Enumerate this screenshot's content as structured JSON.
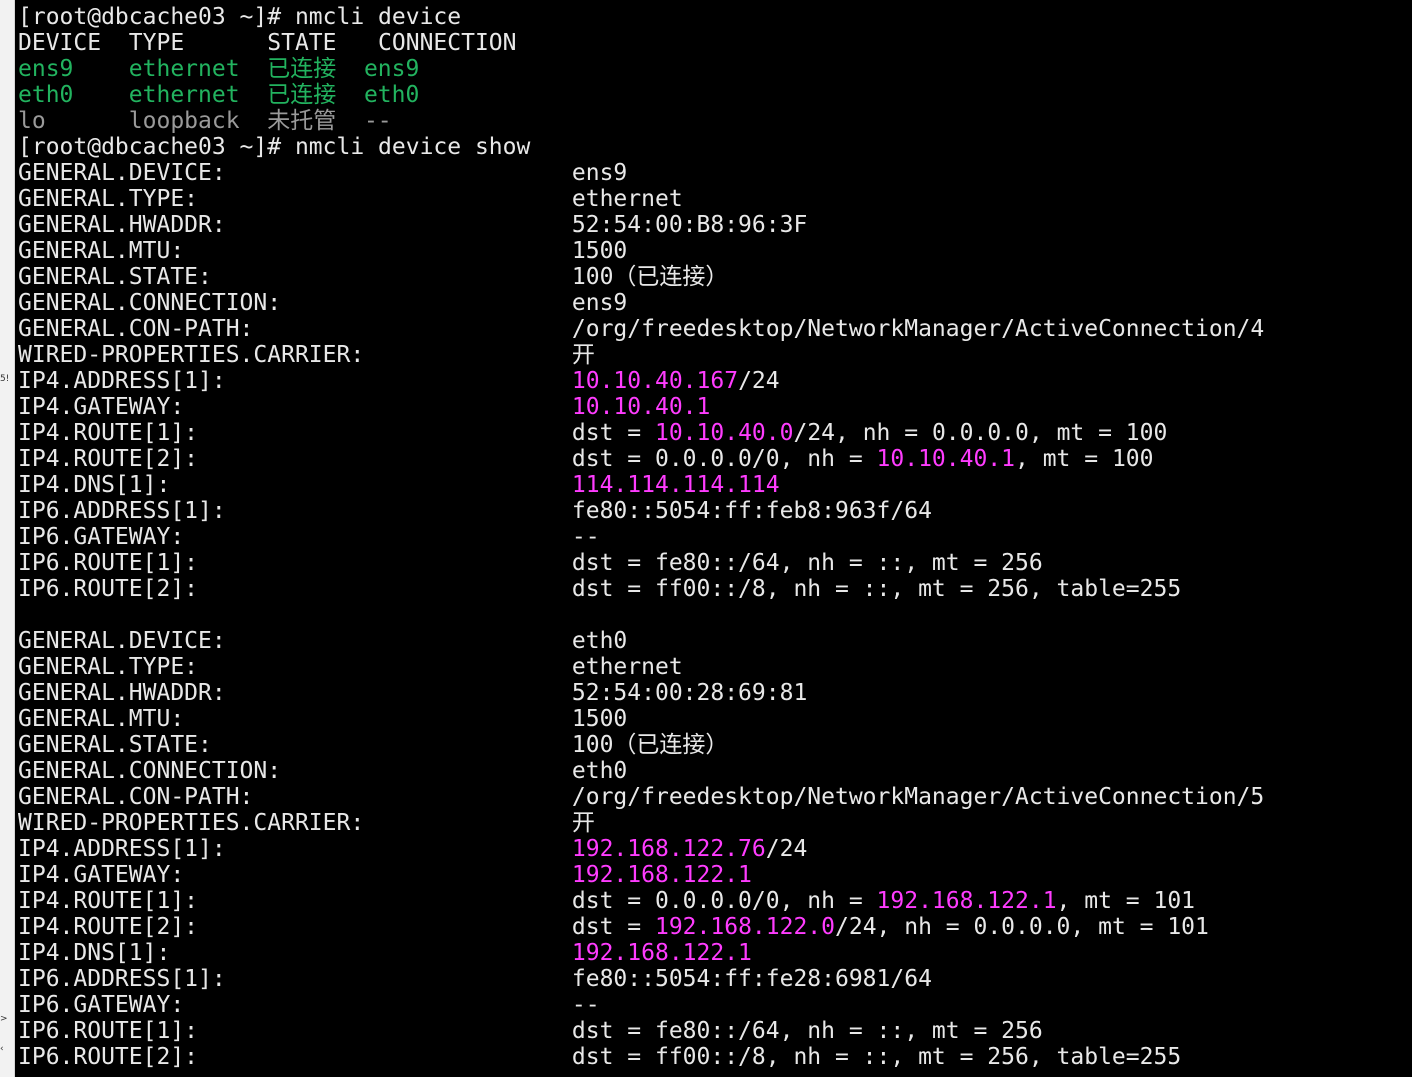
{
  "sidebar_marks": [
    "5!",
    ">",
    "‹"
  ],
  "colors": {
    "background": "#000000",
    "default_text": "#e8e8e8",
    "connected_green": "#22b35f",
    "unmanaged_gray": "#9a9a9a",
    "ip_magenta": "#ff3cff"
  },
  "lines": [
    {
      "segments": [
        {
          "text": "[root@dbcache03 ~]# nmcli device",
          "color": "white"
        }
      ]
    },
    {
      "segments": [
        {
          "text": "DEVICE  TYPE      STATE   CONNECTION",
          "color": "white"
        }
      ]
    },
    {
      "segments": [
        {
          "text": "ens9    ethernet  已连接  ens9",
          "color": "green"
        }
      ]
    },
    {
      "segments": [
        {
          "text": "eth0    ethernet  已连接  eth0",
          "color": "green"
        }
      ]
    },
    {
      "segments": [
        {
          "text": "lo      loopback  未托管  --",
          "color": "gray"
        }
      ]
    },
    {
      "segments": [
        {
          "text": "[root@dbcache03 ~]# nmcli device show",
          "color": "white"
        }
      ]
    },
    {
      "segments": [
        {
          "text": "GENERAL.DEVICE:                         ens9",
          "color": "white"
        }
      ]
    },
    {
      "segments": [
        {
          "text": "GENERAL.TYPE:                           ethernet",
          "color": "white"
        }
      ]
    },
    {
      "segments": [
        {
          "text": "GENERAL.HWADDR:                         52:54:00:B8:96:3F",
          "color": "white"
        }
      ]
    },
    {
      "segments": [
        {
          "text": "GENERAL.MTU:                            1500",
          "color": "white"
        }
      ]
    },
    {
      "segments": [
        {
          "text": "GENERAL.STATE:                          100（已连接）",
          "color": "white"
        }
      ]
    },
    {
      "segments": [
        {
          "text": "GENERAL.CONNECTION:                     ens9",
          "color": "white"
        }
      ]
    },
    {
      "segments": [
        {
          "text": "GENERAL.CON-PATH:                       /org/freedesktop/NetworkManager/ActiveConnection/4",
          "color": "white"
        }
      ]
    },
    {
      "segments": [
        {
          "text": "WIRED-PROPERTIES.CARRIER:               开",
          "color": "white"
        }
      ]
    },
    {
      "segments": [
        {
          "text": "IP4.ADDRESS[1]:                         ",
          "color": "white"
        },
        {
          "text": "10.10.40.167",
          "color": "mag"
        },
        {
          "text": "/24",
          "color": "white"
        }
      ]
    },
    {
      "segments": [
        {
          "text": "IP4.GATEWAY:                            ",
          "color": "white"
        },
        {
          "text": "10.10.40.1",
          "color": "mag"
        }
      ]
    },
    {
      "segments": [
        {
          "text": "IP4.ROUTE[1]:                           dst = ",
          "color": "white"
        },
        {
          "text": "10.10.40.0",
          "color": "mag"
        },
        {
          "text": "/24, nh = 0.0.0.0, mt = 100",
          "color": "white"
        }
      ]
    },
    {
      "segments": [
        {
          "text": "IP4.ROUTE[2]:                           dst = 0.0.0.0/0, nh = ",
          "color": "white"
        },
        {
          "text": "10.10.40.1",
          "color": "mag"
        },
        {
          "text": ", mt = 100",
          "color": "white"
        }
      ]
    },
    {
      "segments": [
        {
          "text": "IP4.DNS[1]:                             ",
          "color": "white"
        },
        {
          "text": "114.114.114.114",
          "color": "mag"
        }
      ]
    },
    {
      "segments": [
        {
          "text": "IP6.ADDRESS[1]:                         fe80::5054:ff:feb8:963f/64",
          "color": "white"
        }
      ]
    },
    {
      "segments": [
        {
          "text": "IP6.GATEWAY:                            --",
          "color": "white"
        }
      ]
    },
    {
      "segments": [
        {
          "text": "IP6.ROUTE[1]:                           dst = fe80::/64, nh = ::, mt = 256",
          "color": "white"
        }
      ]
    },
    {
      "segments": [
        {
          "text": "IP6.ROUTE[2]:                           dst = ff00::/8, nh = ::, mt = 256, table=255",
          "color": "white"
        }
      ]
    },
    {
      "segments": [
        {
          "text": "",
          "color": "white"
        }
      ]
    },
    {
      "segments": [
        {
          "text": "GENERAL.DEVICE:                         eth0",
          "color": "white"
        }
      ]
    },
    {
      "segments": [
        {
          "text": "GENERAL.TYPE:                           ethernet",
          "color": "white"
        }
      ]
    },
    {
      "segments": [
        {
          "text": "GENERAL.HWADDR:                         52:54:00:28:69:81",
          "color": "white"
        }
      ]
    },
    {
      "segments": [
        {
          "text": "GENERAL.MTU:                            1500",
          "color": "white"
        }
      ]
    },
    {
      "segments": [
        {
          "text": "GENERAL.STATE:                          100（已连接）",
          "color": "white"
        }
      ]
    },
    {
      "segments": [
        {
          "text": "GENERAL.CONNECTION:                     eth0",
          "color": "white"
        }
      ]
    },
    {
      "segments": [
        {
          "text": "GENERAL.CON-PATH:                       /org/freedesktop/NetworkManager/ActiveConnection/5",
          "color": "white"
        }
      ]
    },
    {
      "segments": [
        {
          "text": "WIRED-PROPERTIES.CARRIER:               开",
          "color": "white"
        }
      ]
    },
    {
      "segments": [
        {
          "text": "IP4.ADDRESS[1]:                         ",
          "color": "white"
        },
        {
          "text": "192.168.122.76",
          "color": "mag"
        },
        {
          "text": "/24",
          "color": "white"
        }
      ]
    },
    {
      "segments": [
        {
          "text": "IP4.GATEWAY:                            ",
          "color": "white"
        },
        {
          "text": "192.168.122.1",
          "color": "mag"
        }
      ]
    },
    {
      "segments": [
        {
          "text": "IP4.ROUTE[1]:                           dst = 0.0.0.0/0, nh = ",
          "color": "white"
        },
        {
          "text": "192.168.122.1",
          "color": "mag"
        },
        {
          "text": ", mt = 101",
          "color": "white"
        }
      ]
    },
    {
      "segments": [
        {
          "text": "IP4.ROUTE[2]:                           dst = ",
          "color": "white"
        },
        {
          "text": "192.168.122.0",
          "color": "mag"
        },
        {
          "text": "/24, nh = 0.0.0.0, mt = 101",
          "color": "white"
        }
      ]
    },
    {
      "segments": [
        {
          "text": "IP4.DNS[1]:                             ",
          "color": "white"
        },
        {
          "text": "192.168.122.1",
          "color": "mag"
        }
      ]
    },
    {
      "segments": [
        {
          "text": "IP6.ADDRESS[1]:                         fe80::5054:ff:fe28:6981/64",
          "color": "white"
        }
      ]
    },
    {
      "segments": [
        {
          "text": "IP6.GATEWAY:                            --",
          "color": "white"
        }
      ]
    },
    {
      "segments": [
        {
          "text": "IP6.ROUTE[1]:                           dst = fe80::/64, nh = ::, mt = 256",
          "color": "white"
        }
      ]
    },
    {
      "segments": [
        {
          "text": "IP6.ROUTE[2]:                           dst = ff00::/8, nh = ::, mt = 256, table=255",
          "color": "white"
        }
      ]
    }
  ]
}
